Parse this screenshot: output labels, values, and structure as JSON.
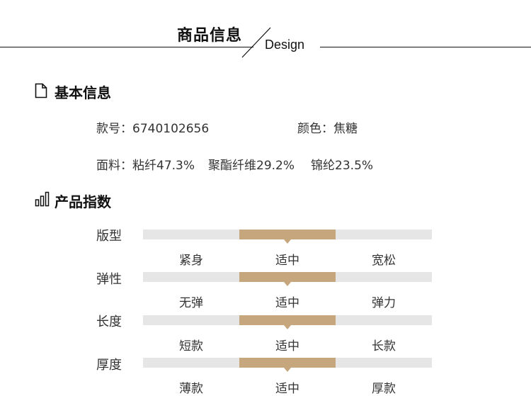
{
  "header": {
    "title": "商品信息",
    "subtitle": "Design"
  },
  "basic_info": {
    "section_title": "基本信息",
    "icon": "document-icon",
    "style_no_label": "款号：",
    "style_no_value": "6740102656",
    "color_label": "颜色：",
    "color_value": "焦糖",
    "fabric_label": "面料：",
    "fabric_items": [
      "粘纤47.3%",
      "聚酯纤维29.2%",
      "锦纶23.5%"
    ]
  },
  "product_index": {
    "section_title": "产品指数",
    "icon": "bar-chart-icon",
    "accent_color": "#c5a67d",
    "track_color": "#e6e6e6",
    "rows": [
      {
        "label": "版型",
        "options": [
          "紧身",
          "适中",
          "宽松"
        ],
        "selected_index": 1
      },
      {
        "label": "弹性",
        "options": [
          "无弹",
          "适中",
          "弹力"
        ],
        "selected_index": 1
      },
      {
        "label": "长度",
        "options": [
          "短款",
          "适中",
          "长款"
        ],
        "selected_index": 1
      },
      {
        "label": "厚度",
        "options": [
          "薄款",
          "适中",
          "厚款"
        ],
        "selected_index": 1
      }
    ]
  }
}
